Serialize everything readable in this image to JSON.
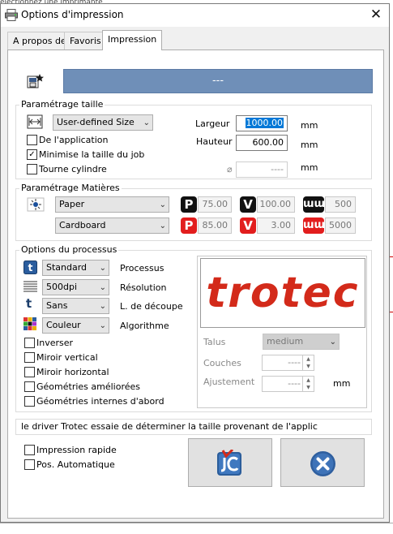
{
  "background": {
    "top_text": "electionnez une imprimante"
  },
  "window": {
    "title": "Options d'impression",
    "close_glyph": "✕"
  },
  "tabs": [
    {
      "label": "A propos de"
    },
    {
      "label": "Favoris"
    },
    {
      "label": "Impression"
    }
  ],
  "favorite_bar": {
    "value": "---"
  },
  "size_group": {
    "title": "Paramétrage taille",
    "size_select": "User-defined Size",
    "width_label": "Largeur",
    "width_value": "1000.00",
    "height_label": "Hauteur",
    "height_value": "600.00",
    "unit": "mm",
    "diameter_symbol": "⌀",
    "diameter_value": "----",
    "checkboxes": [
      {
        "label": "De l'application",
        "checked": false
      },
      {
        "label": "Minimise la taille du job",
        "checked": true
      },
      {
        "label": "Tourne cylindre",
        "checked": false
      }
    ]
  },
  "material_group": {
    "title": "Paramétrage Matières",
    "material": "Paper",
    "sub_material": "Cardboard",
    "engrave": {
      "power": "75.00",
      "speed": "100.00",
      "ppi": "500"
    },
    "cut": {
      "power": "85.00",
      "speed": "3.00",
      "hz": "5000"
    },
    "badges": {
      "power": "P",
      "speed": "V",
      "freq": "ɯɯ"
    }
  },
  "process_group": {
    "title": "Options du processus",
    "process": {
      "value": "Standard",
      "label": "Processus"
    },
    "resolution": {
      "value": "500dpi",
      "label": "Résolution"
    },
    "cutline": {
      "value": "Sans",
      "label": "L. de découpe"
    },
    "algorithm": {
      "value": "Couleur",
      "label": "Algorithme"
    },
    "checkboxes": [
      {
        "label": "Inverser"
      },
      {
        "label": "Miroir vertical"
      },
      {
        "label": "Miroir horizontal"
      },
      {
        "label": "Géométries améliorées"
      },
      {
        "label": "Géométries internes d'abord"
      }
    ],
    "logo_text": "trotec",
    "talus": {
      "label": "Talus",
      "value": "medium"
    },
    "passes": {
      "label": "Couches",
      "value": "----"
    },
    "adjust": {
      "label": "Ajustement",
      "value": "----",
      "unit": "mm"
    }
  },
  "status_text": "le driver Trotec essaie de déterminer la taille provenant de l'applic",
  "bottom_checks": [
    {
      "label": "Impression rapide"
    },
    {
      "label": "Pos. Automatique"
    }
  ],
  "colors": {
    "accent": "#0078d7",
    "favorite_bar": "#6f8fb8",
    "brand_red": "#d32a1a"
  }
}
